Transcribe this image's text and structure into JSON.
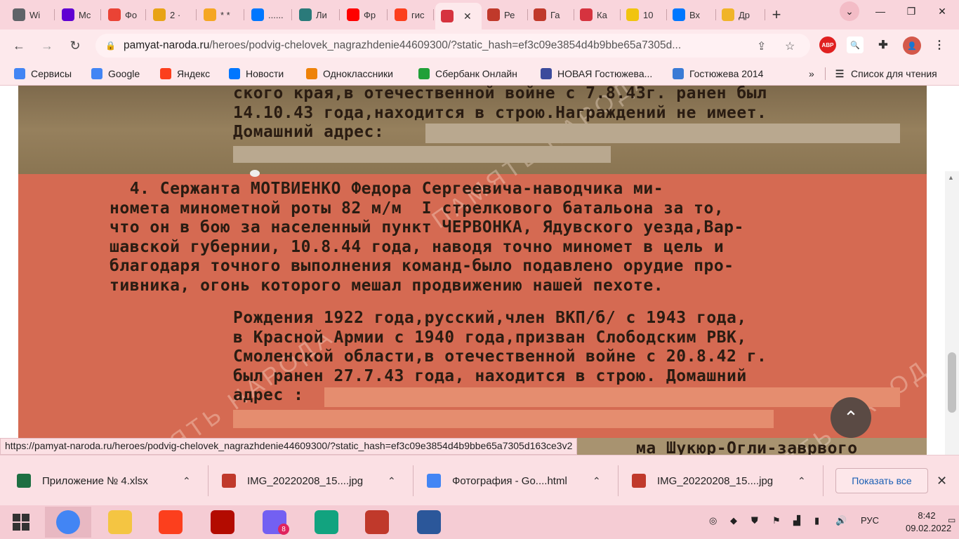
{
  "tabs": [
    {
      "label": "Wi",
      "icon": "chrome-icon",
      "color": "#5f6368"
    },
    {
      "label": "Mc",
      "icon": "yahoo-icon",
      "color": "#6001d2"
    },
    {
      "label": "Фо",
      "icon": "photos-icon",
      "color": "#ea4335"
    },
    {
      "label": "2 ·",
      "icon": "mail-icon",
      "color": "#e8a317"
    },
    {
      "label": "* *",
      "icon": "mail-ru-icon",
      "color": "#f5a623"
    },
    {
      "label": "......",
      "icon": "vk-icon",
      "color": "#0077ff"
    },
    {
      "label": "Ли",
      "icon": "globe-icon",
      "color": "#2a7a7a"
    },
    {
      "label": "Фр",
      "icon": "youtube-icon",
      "color": "#ff0000"
    },
    {
      "label": "гис",
      "icon": "yandex-icon",
      "color": "#fc3f1d"
    },
    {
      "label": "",
      "icon": "star-icon",
      "color": "#d6333f",
      "active": true
    },
    {
      "label": "Ре",
      "icon": "medal-icon",
      "color": "#c0392b"
    },
    {
      "label": "Га",
      "icon": "medal-icon",
      "color": "#c0392b"
    },
    {
      "label": "Ка",
      "icon": "star-icon",
      "color": "#d6333f"
    },
    {
      "label": "10",
      "icon": "image-icon",
      "color": "#f1c40f"
    },
    {
      "label": "Вх",
      "icon": "vk-icon",
      "color": "#0077ff"
    },
    {
      "label": "Др",
      "icon": "sun-icon",
      "color": "#f0b429"
    }
  ],
  "omnibox": {
    "host": "pamyat-naroda.ru",
    "path": "/heroes/podvig-chelovek_nagrazhdenie44609300/?static_hash=ef3c09e3854d4b9bbe65a7305d..."
  },
  "bookmarks": [
    {
      "label": "Сервисы",
      "icon": "apps-icon",
      "color": "#4285f4"
    },
    {
      "label": "Google",
      "icon": "google-icon",
      "color": "#4285f4"
    },
    {
      "label": "Яндекс",
      "icon": "yandex-icon",
      "color": "#fc3f1d"
    },
    {
      "label": "Новости",
      "icon": "vk-icon",
      "color": "#0077ff"
    },
    {
      "label": "Одноклассники",
      "icon": "ok-icon",
      "color": "#ee8208"
    },
    {
      "label": "Сбербанк Онлайн",
      "icon": "sber-icon",
      "color": "#21a038"
    },
    {
      "label": "НОВАЯ Гостюжева...",
      "icon": "doc-icon",
      "color": "#3c4b9c"
    },
    {
      "label": "Гостюжева 2014",
      "icon": "site-icon",
      "color": "#3a7bd5"
    }
  ],
  "reading_list": "Список для чтения",
  "document": {
    "block3": [
      "ского края,в отечественной войне с 7.8.43г. ранен был",
      "14.10.43 года,находится в строю.Награждений не имеет.",
      "Домашний адрес:"
    ],
    "block4": [
      "  4. Сержанта МОТВИЕНКО Федора Сергеевича-наводчика ми-",
      "номета минометной роты 82 м/м  I стрелкового батальона за то,",
      "что он в бою за населенный пункт ЧЕРВОНКА, Ядувского уезда,Вар-",
      "шавской губернии, 10.8.44 года, наводя точно миномет в цель и",
      "благодаря точного выполнения команд-было подавлено орудие про-",
      "тивника, огонь которого мешал продвижению нашей пехоте."
    ],
    "block4b": [
      "Рождения 1922 года,русский,член ВКП/б/ с 1943 года,",
      "в Красной Армии с 1940 года,призван Слободским РВК,",
      "Смоленской области,в отечественной войне с 20.8.42 г.",
      "был ранен 27.7.43 года, находится в строю. Домашний",
      "адрес :"
    ],
    "block_bottom": "ма Шукюр-Огли-заврвого"
  },
  "status_url": "https://pamyat-naroda.ru/heroes/podvig-chelovek_nagrazhdenie44609300/?static_hash=ef3c09e3854d4b9bbe65a7305d163ce3v2",
  "downloads": [
    {
      "label": "Приложение № 4.xlsx",
      "icon": "excel-icon",
      "color": "#1d6f42"
    },
    {
      "label": "IMG_20220208_15....jpg",
      "icon": "image-file-icon",
      "color": "#c0392b"
    },
    {
      "label": "Фотография - Go....html",
      "icon": "chrome-icon",
      "color": "#4285f4"
    },
    {
      "label": "IMG_20220208_15....jpg",
      "icon": "image-file-icon",
      "color": "#c0392b"
    }
  ],
  "show_all": "Показать все",
  "taskbar": {
    "apps": [
      {
        "name": "chrome",
        "icon": "chrome-icon",
        "color": "#4285f4"
      },
      {
        "name": "explorer",
        "icon": "folder-icon",
        "color": "#f4c542"
      },
      {
        "name": "yandex-browser",
        "icon": "yandex-icon",
        "color": "#fc3f1d"
      },
      {
        "name": "acrobat",
        "icon": "pdf-icon",
        "color": "#b30b00"
      },
      {
        "name": "viber",
        "icon": "viber-icon",
        "color": "#7360f2",
        "badge": "8"
      },
      {
        "name": "vpn",
        "icon": "shield-icon",
        "color": "#12a37f"
      },
      {
        "name": "photo-viewer",
        "icon": "photo-icon",
        "color": "#c0392b"
      },
      {
        "name": "word",
        "icon": "word-icon",
        "color": "#2b579a"
      }
    ],
    "lang": "РУС",
    "time": "8:42",
    "date": "09.02.2022"
  },
  "watermark": "ПАМЯТЬ НАРОДА"
}
